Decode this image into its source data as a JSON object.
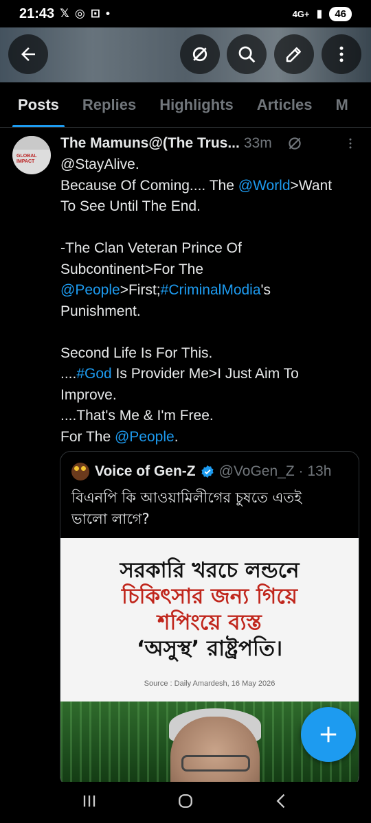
{
  "status_bar": {
    "time": "21:43",
    "network": "4G+",
    "battery": "46"
  },
  "header": {
    "back_icon": "arrow-left-icon",
    "actions": [
      "grok-icon",
      "search-icon",
      "edit-icon",
      "more-vertical-icon"
    ]
  },
  "tabs": [
    {
      "label": "Posts",
      "active": true
    },
    {
      "label": "Replies",
      "active": false
    },
    {
      "label": "Highlights",
      "active": false
    },
    {
      "label": "Articles",
      "active": false
    },
    {
      "label": "M",
      "active": false
    }
  ],
  "post": {
    "author_name": "The Mamuns@(The Trus...",
    "time": "33m",
    "body_lines": [
      [
        {
          "t": "@StayAlive."
        }
      ],
      [
        {
          "t": "Because Of Coming.... The "
        },
        {
          "t": "@World",
          "link": true
        },
        {
          "t": ">Want"
        }
      ],
      [
        {
          "t": "To See Until The End."
        }
      ],
      [
        {
          "t": ""
        }
      ],
      [
        {
          "t": "-The Clan Veteran Prince Of"
        }
      ],
      [
        {
          "t": "Subcontinent>For The"
        }
      ],
      [
        {
          "t": "@People",
          "link": true
        },
        {
          "t": ">First;"
        },
        {
          "t": "#CriminalModia",
          "link": true
        },
        {
          "t": "'s"
        }
      ],
      [
        {
          "t": "Punishment."
        }
      ],
      [
        {
          "t": ""
        }
      ],
      [
        {
          "t": "Second Life Is For This."
        }
      ],
      [
        {
          "t": "...."
        },
        {
          "t": "#God",
          "link": true
        },
        {
          "t": " Is Provider Me>I Just Aim To"
        }
      ],
      [
        {
          "t": "Improve."
        }
      ],
      [
        {
          "t": "....That's Me & I'm Free."
        }
      ],
      [
        {
          "t": "For The "
        },
        {
          "t": "@People",
          "link": true
        },
        {
          "t": "."
        }
      ]
    ],
    "avatar_text": "GLOBAL IMPACT"
  },
  "quote": {
    "name": "Voice of Gen-Z",
    "handle": "@VoGen_Z · 13h",
    "text_lines": [
      "বিএনপি কি আওয়ামিলীগের চুষতে এতই",
      "ভালো লাগে?"
    ],
    "image": {
      "headline_lines": [
        {
          "t": "সরকারি খরচে লন্ডনে",
          "color": "black"
        },
        {
          "t": "চিকিৎসার জন্য গিয়ে",
          "color": "red"
        },
        {
          "t": "শপিংয়ে ব্যস্ত",
          "color": "red"
        },
        {
          "t": "‘অসুস্থ’ রাষ্ট্রপতি।",
          "color": "black"
        }
      ],
      "source": "Source : Daily Amardesh, 16 May 2026"
    }
  },
  "fab": {
    "icon": "plus-icon"
  },
  "navbar": [
    "recents-icon",
    "home-icon",
    "back-icon"
  ],
  "colors": {
    "accent": "#1d9bf0",
    "background": "#000000",
    "muted": "#71767b"
  }
}
